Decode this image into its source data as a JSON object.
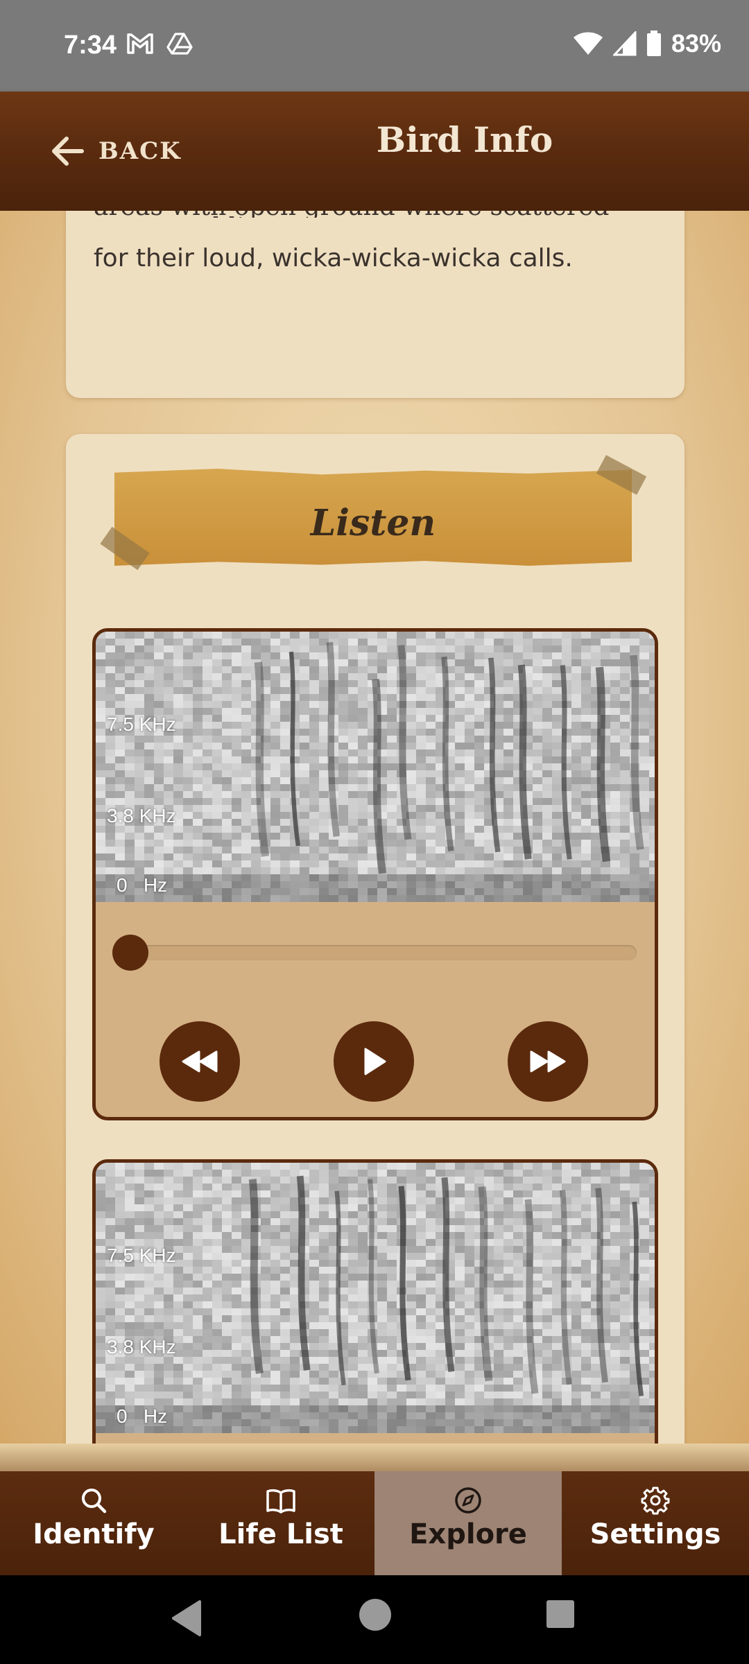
{
  "status_bar": {
    "time": "7:34",
    "battery": "83%",
    "icons": [
      "gmail-icon",
      "drive-icon",
      "wifi-icon",
      "signal-icon",
      "battery-icon"
    ]
  },
  "header": {
    "back_label": "BACK",
    "title": "Bird Info"
  },
  "description": {
    "cutoff_text": "areas with open ground where scattered trees, and listen",
    "text": "for their loud, wicka-wicka-wicka calls."
  },
  "listen": {
    "title": "Listen",
    "recordings": [
      {
        "freq_labels": [
          "7.5 KHz",
          "3.8 KHz",
          "0   Hz"
        ],
        "progress": 0
      },
      {
        "freq_labels": [
          "7.5 KHz",
          "3.8 KHz",
          "0   Hz"
        ]
      }
    ]
  },
  "bottom_nav": {
    "items": [
      {
        "label": "Identify",
        "icon": "search-icon"
      },
      {
        "label": "Life List",
        "icon": "book-icon"
      },
      {
        "label": "Explore",
        "icon": "compass-icon",
        "active": true
      },
      {
        "label": "Settings",
        "icon": "gear-icon"
      }
    ]
  },
  "colors": {
    "header_brown": "#5a2b0f",
    "player_brown": "#5b2a0d",
    "banner_gold": "#d6a64f",
    "active_tab": "#9d8474"
  }
}
